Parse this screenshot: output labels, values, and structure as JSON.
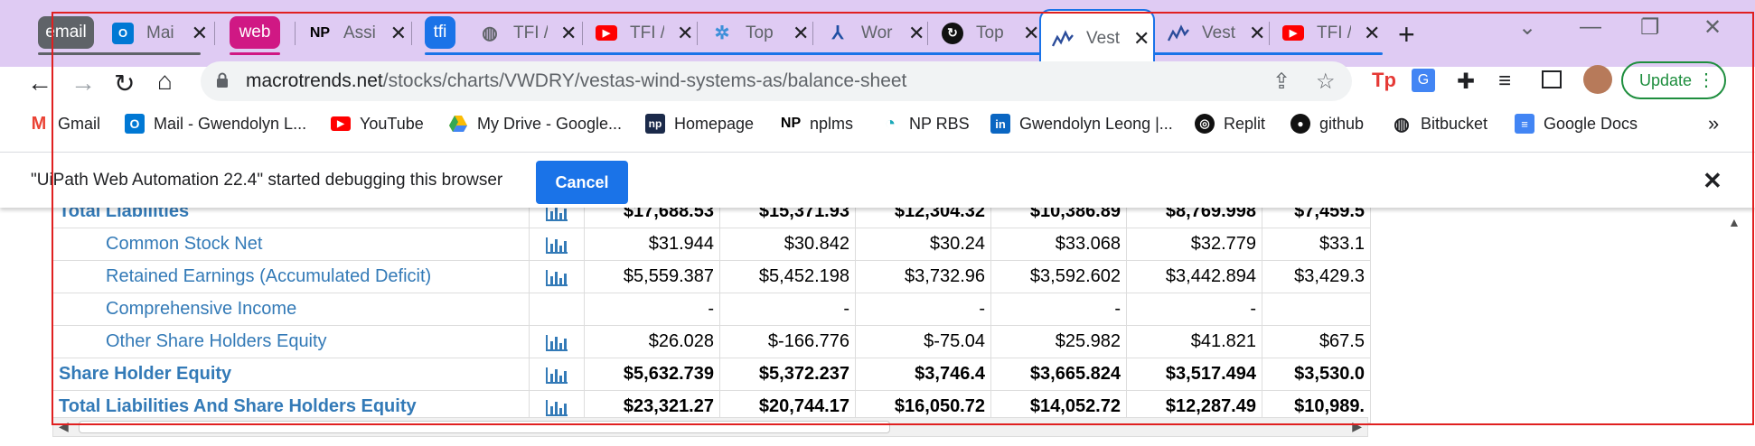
{
  "tab_groups": [
    {
      "label": "email",
      "color": "#5f6368"
    },
    {
      "label": "web",
      "color": "#d01884"
    },
    {
      "label": "tfi",
      "color": "#1a73e8"
    }
  ],
  "tabs": [
    {
      "icon": "outlook-mail-icon",
      "title": "Mai"
    },
    {
      "icon": "np-icon",
      "title": "Assi"
    },
    {
      "icon": "globe-icon",
      "title": "TFI /"
    },
    {
      "icon": "youtube-icon",
      "title": "TFI /"
    },
    {
      "icon": "network-icon",
      "title": "Top"
    },
    {
      "icon": "wind-turbine-icon",
      "title": "Wor"
    },
    {
      "icon": "circle-logo-icon",
      "title": "Top"
    },
    {
      "icon": "macrotrends-icon",
      "title": "Vest"
    },
    {
      "icon": "macrotrends-icon",
      "title": "Vest"
    },
    {
      "icon": "youtube-icon",
      "title": "TFI /"
    }
  ],
  "address_bar": {
    "domain": "macrotrends.net",
    "path": "/stocks/charts/VWDRY/vestas-wind-systems-as/balance-sheet"
  },
  "update_button": "Update",
  "bookmarks": [
    {
      "icon": "gmail-icon",
      "label": "Gmail"
    },
    {
      "icon": "outlook-mail-icon",
      "label": "Mail - Gwendolyn L..."
    },
    {
      "icon": "youtube-icon",
      "label": "YouTube"
    },
    {
      "icon": "google-drive-icon",
      "label": "My Drive - Google..."
    },
    {
      "icon": "np-icon",
      "label": "Homepage"
    },
    {
      "icon": "np-icon",
      "label": "nplms"
    },
    {
      "icon": "np-rbs-icon",
      "label": "NP RBS"
    },
    {
      "icon": "linkedin-icon",
      "label": "Gwendolyn Leong |..."
    },
    {
      "icon": "replit-icon",
      "label": "Replit"
    },
    {
      "icon": "github-icon",
      "label": "github"
    },
    {
      "icon": "globe-icon",
      "label": "Bitbucket"
    },
    {
      "icon": "google-docs-icon",
      "label": "Google Docs"
    }
  ],
  "bookmarks_overflow": "»",
  "infobar": {
    "message": "\"UiPath Web Automation 22.4\" started debugging this browser",
    "cancel_label": "Cancel"
  },
  "balance_sheet": {
    "rows": [
      {
        "label": "Total Liabilities",
        "style": "bold",
        "chart": true,
        "values": [
          "$17,688.53",
          "$15,371.93",
          "$12,304.32",
          "$10,386.89",
          "$8,769.998",
          "$7,459.5"
        ]
      },
      {
        "label": "Common Stock Net",
        "style": "sub",
        "chart": true,
        "values": [
          "$31.944",
          "$30.842",
          "$30.24",
          "$33.068",
          "$32.779",
          "$33.1"
        ]
      },
      {
        "label": "Retained Earnings (Accumulated Deficit)",
        "style": "sub",
        "chart": true,
        "values": [
          "$5,559.387",
          "$5,452.198",
          "$3,732.96",
          "$3,592.602",
          "$3,442.894",
          "$3,429.3"
        ]
      },
      {
        "label": "Comprehensive Income",
        "style": "sub",
        "chart": false,
        "values": [
          "-",
          "-",
          "-",
          "-",
          "-",
          ""
        ]
      },
      {
        "label": "Other Share Holders Equity",
        "style": "sub",
        "chart": true,
        "values": [
          "$26.028",
          "$-166.776",
          "$-75.04",
          "$25.982",
          "$41.821",
          "$67.5"
        ]
      },
      {
        "label": "Share Holder Equity",
        "style": "bold",
        "chart": true,
        "values": [
          "$5,632.739",
          "$5,372.237",
          "$3,746.4",
          "$3,665.824",
          "$3,517.494",
          "$3,530.0"
        ]
      },
      {
        "label": "Total Liabilities And Share Holders Equity",
        "style": "bold",
        "chart": true,
        "values": [
          "$23,321.27",
          "$20,744.17",
          "$16,050.72",
          "$14,052.72",
          "$12,287.49",
          "$10,989."
        ]
      }
    ]
  }
}
